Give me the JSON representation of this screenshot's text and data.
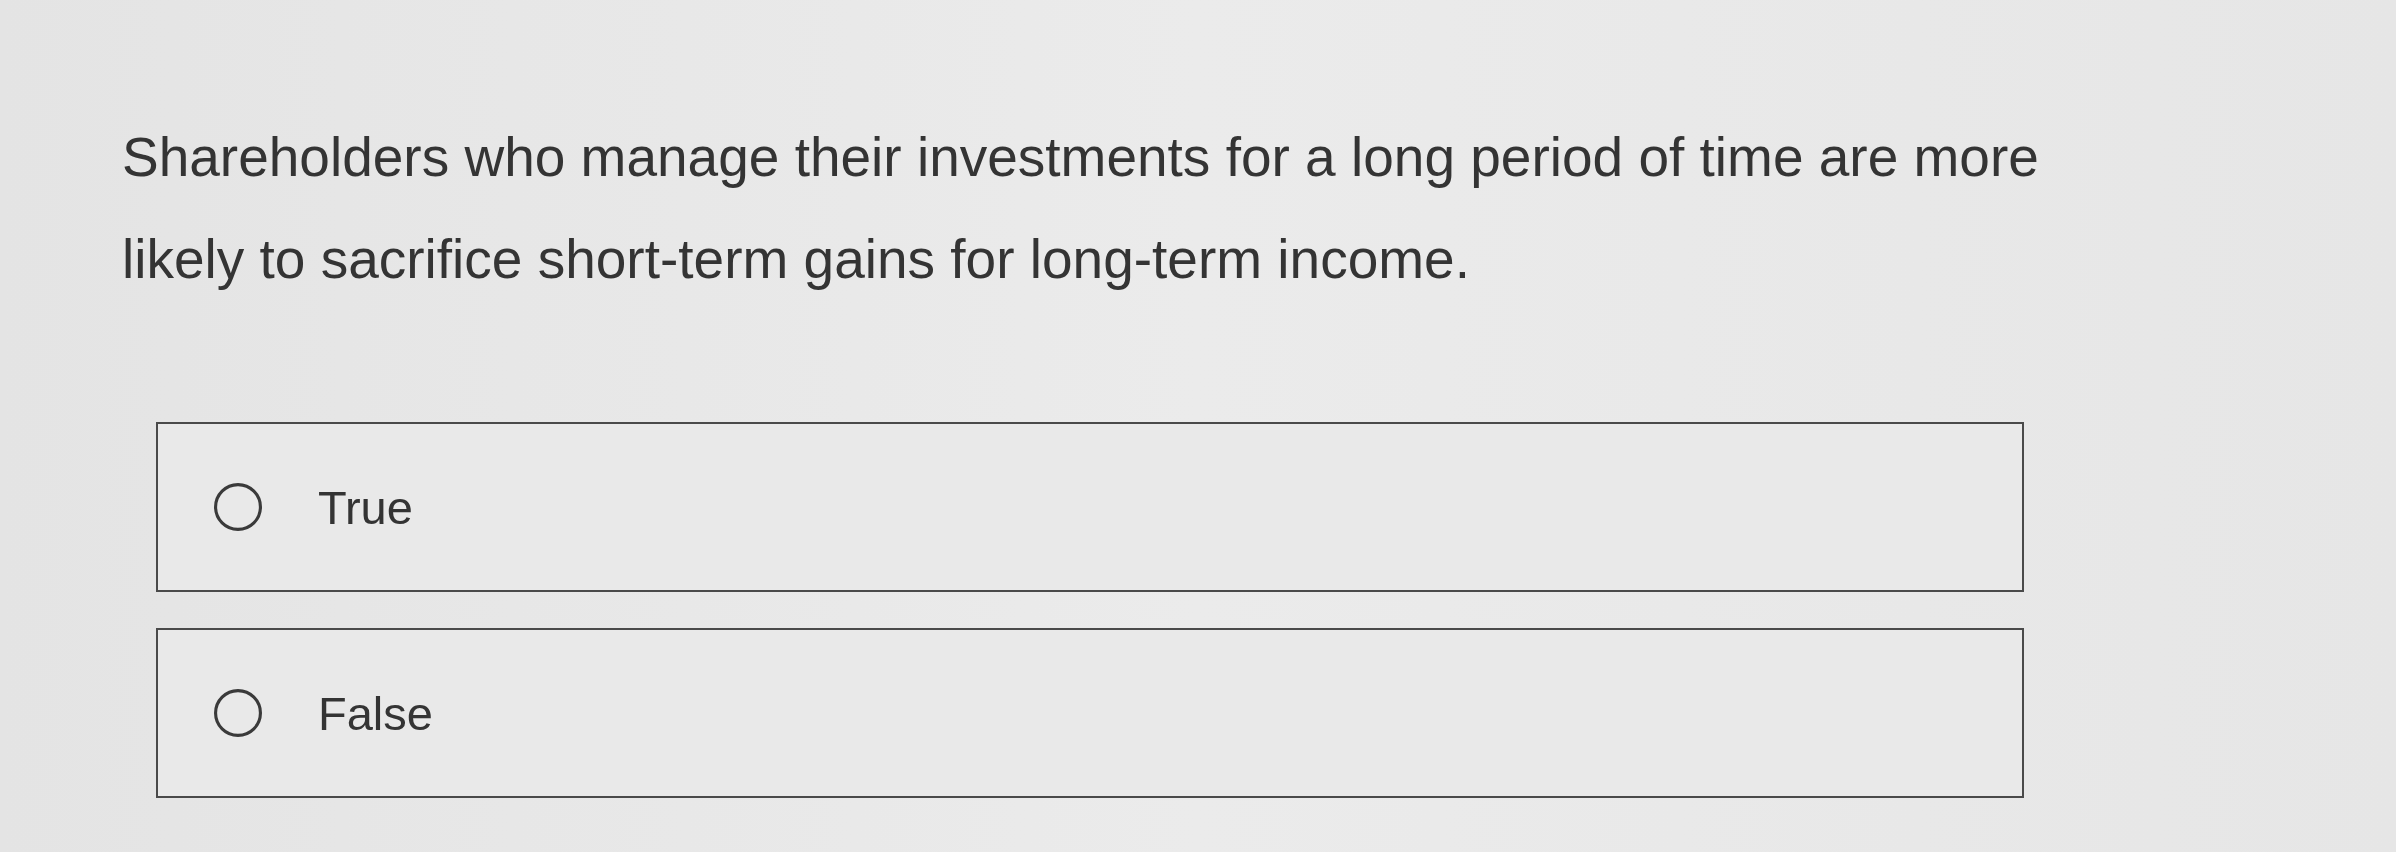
{
  "question": "Shareholders who manage their investments for a long period of time are more likely to sacrifice short-term gains for long-term income.",
  "options": [
    {
      "label": "True",
      "selected": false
    },
    {
      "label": "False",
      "selected": false
    }
  ]
}
